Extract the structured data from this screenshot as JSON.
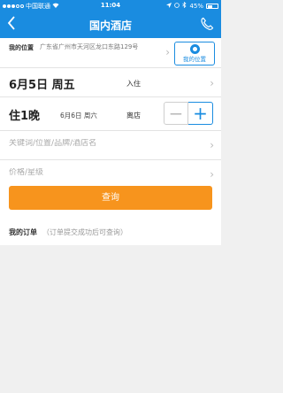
{
  "status": {
    "carrier": "中国联通",
    "time": "11:04",
    "battery": "45%"
  },
  "nav": {
    "title": "国内酒店",
    "back_icon": "back-arrow-icon",
    "phone_icon": "phone-icon"
  },
  "location": {
    "label": "我的位置",
    "address": "广东省广州市天河区龙口东路129号",
    "button_label": "我的位置"
  },
  "checkin": {
    "date": "6月5日 周五",
    "tag": "入住"
  },
  "checkout": {
    "nights": "住1晚",
    "date": "6月6日 周六",
    "tag": "离店",
    "minus": "−",
    "plus": "+"
  },
  "keyword": {
    "placeholder": "关键词/位置/品牌/酒店名"
  },
  "price": {
    "placeholder": "价格/星级"
  },
  "search_button": "查询",
  "orders": {
    "title": "我的订单",
    "hint": "（订单提交成功后可查询）"
  },
  "colors": {
    "accent": "#1a8ce0",
    "search": "#f7941d"
  }
}
